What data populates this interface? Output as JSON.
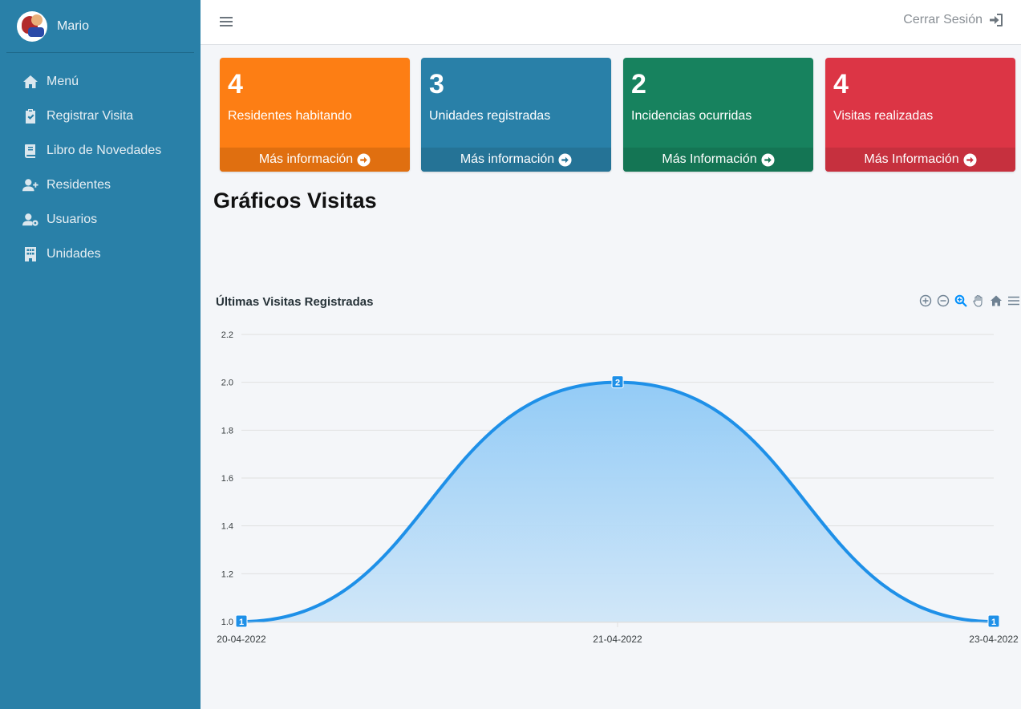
{
  "sidebar": {
    "user_name": "Mario",
    "items": [
      {
        "label": "Menú",
        "icon": "home-icon"
      },
      {
        "label": "Registrar Visita",
        "icon": "clipboard-check-icon"
      },
      {
        "label": "Libro de Novedades",
        "icon": "book-icon"
      },
      {
        "label": "Residentes",
        "icon": "user-plus-icon"
      },
      {
        "label": "Usuarios",
        "icon": "users-cog-icon"
      },
      {
        "label": "Unidades",
        "icon": "building-icon"
      }
    ]
  },
  "topbar": {
    "logout_label": "Cerrar Sesión"
  },
  "boxes": [
    {
      "number": "4",
      "text": "Residentes habitando",
      "link": "Más información",
      "color": "#fd7e14",
      "footer_color": "#e06f10"
    },
    {
      "number": "3",
      "text": "Unidades registradas",
      "link": "Más información",
      "color": "#2980a8",
      "footer_color": "#257396"
    },
    {
      "number": "2",
      "text": "Incidencias ocurridas",
      "link": "Más Información",
      "color": "#17825e",
      "footer_color": "#147554"
    },
    {
      "number": "4",
      "text": "Visitas realizadas",
      "link": "Más Información",
      "color": "#dc3545",
      "footer_color": "#c6303e"
    }
  ],
  "main": {
    "section_title": "Gráficos Visitas"
  },
  "chart_data": {
    "type": "area",
    "title": "Últimas Visitas Registradas",
    "x": [
      "20-04-2022",
      "21-04-2022",
      "23-04-2022"
    ],
    "series": [
      {
        "values": [
          1,
          2,
          1
        ]
      }
    ],
    "ylim": [
      1.0,
      2.2
    ],
    "yticks": [
      "1.0",
      "1.2",
      "1.4",
      "1.6",
      "1.8",
      "2.0",
      "2.2"
    ],
    "grid": true,
    "data_labels": true,
    "color": "#1e90e8"
  }
}
